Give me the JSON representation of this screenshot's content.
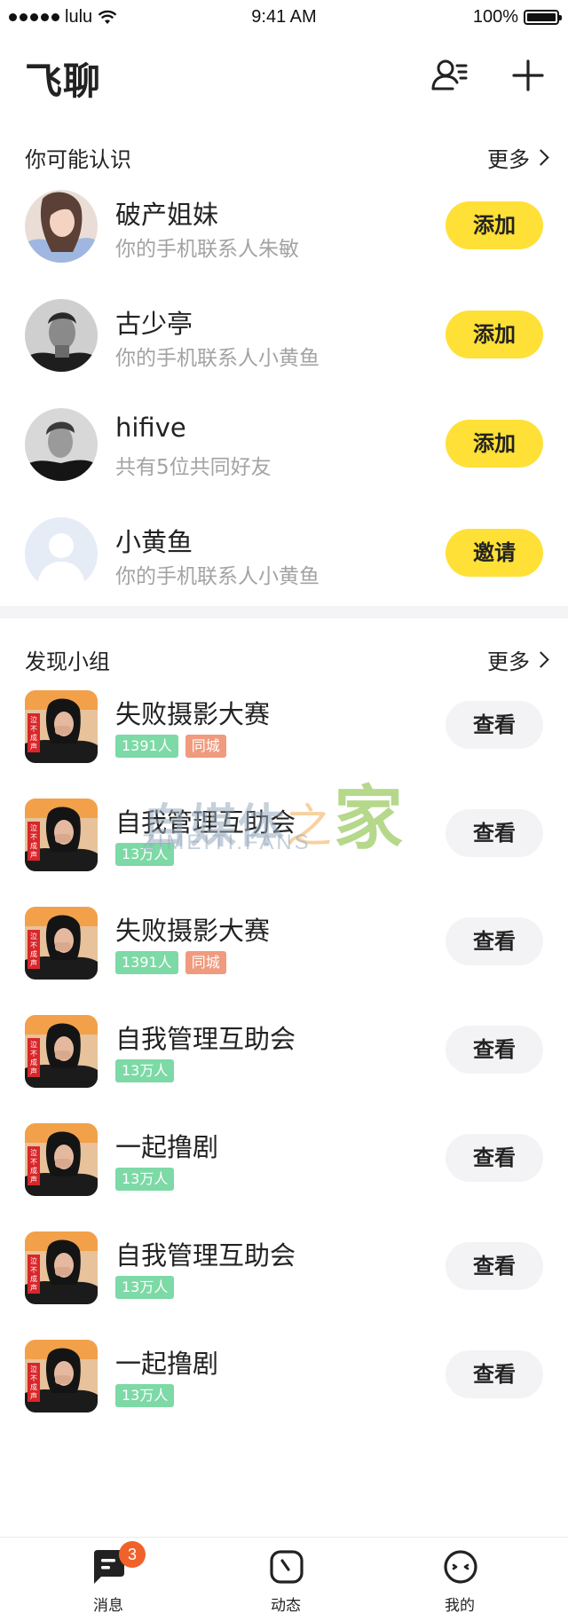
{
  "status_bar": {
    "carrier": "lulu",
    "time": "9:41 AM",
    "battery": "100%"
  },
  "header": {
    "title": "飞聊",
    "contacts_icon": "contacts-icon",
    "add_icon": "plus-icon"
  },
  "people_section": {
    "title": "你可能认识",
    "more": "更多",
    "items": [
      {
        "name": "破产姐妹",
        "sub": "你的手机联系人朱敏",
        "action": "添加"
      },
      {
        "name": "古少亭",
        "sub": "你的手机联系人小黄鱼",
        "action": "添加"
      },
      {
        "name": "hifive",
        "sub": "共有5位共同好友",
        "action": "添加"
      },
      {
        "name": "小黄鱼",
        "sub": "你的手机联系人小黄鱼",
        "action": "邀请"
      }
    ]
  },
  "groups_section": {
    "title": "发现小组",
    "more": "更多",
    "items": [
      {
        "name": "失败摄影大赛",
        "count": "1391人",
        "city": "同城",
        "action": "查看"
      },
      {
        "name": "自我管理互助会",
        "count": "13万人",
        "action": "查看"
      },
      {
        "name": "失败摄影大赛",
        "count": "1391人",
        "city": "同城",
        "action": "查看"
      },
      {
        "name": "自我管理互助会",
        "count": "13万人",
        "action": "查看"
      },
      {
        "name": "一起撸剧",
        "count": "13万人",
        "action": "查看"
      },
      {
        "name": "自我管理互助会",
        "count": "13万人",
        "action": "查看"
      },
      {
        "name": "一起撸剧",
        "count": "13万人",
        "action": "查看"
      }
    ],
    "thumb_label": "泣不成声"
  },
  "watermark": {
    "main_a": "自媒体",
    "main_b": "之",
    "main_c": "家",
    "sub": "ZIMEITI.FANS"
  },
  "tabbar": {
    "tabs": [
      {
        "label": "消息",
        "badge": "3"
      },
      {
        "label": "动态"
      },
      {
        "label": "我的"
      }
    ]
  },
  "colors": {
    "accent_yellow": "#ffe036",
    "tag_green": "#7dd9a6",
    "tag_orange": "#f09a7e",
    "badge_orange": "#f0622a"
  }
}
